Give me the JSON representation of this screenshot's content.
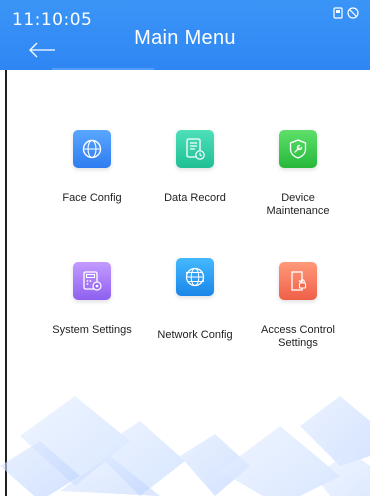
{
  "status_bar": {
    "time": "11:10:05"
  },
  "header": {
    "title": "Main Menu",
    "back_icon": "arrow-left-icon"
  },
  "menu": {
    "items": [
      {
        "id": "face-config",
        "label": "Face Config",
        "icon": "face-scan-icon",
        "color_top": "#5aa7ff",
        "color_bottom": "#2e7cf0"
      },
      {
        "id": "data-record",
        "label": "Data Record",
        "icon": "document-clock-icon",
        "color_top": "#4fe0b8",
        "color_bottom": "#1fbf94"
      },
      {
        "id": "device-maintenance",
        "label": "Device\nMaintenance",
        "icon": "wrench-shield-icon",
        "color_top": "#5ee06b",
        "color_bottom": "#26b83a"
      },
      {
        "id": "system-settings",
        "label": "System Settings",
        "icon": "calculator-gear-icon",
        "color_top": "#c49bff",
        "color_bottom": "#8e60f0"
      },
      {
        "id": "network-config",
        "label": "Network Config",
        "icon": "globe-icon",
        "color_top": "#45b9ff",
        "color_bottom": "#1a86e8"
      },
      {
        "id": "access-control-settings",
        "label": "Access Control\nSettings",
        "icon": "door-lock-icon",
        "color_top": "#ff9a7a",
        "color_bottom": "#f05f48"
      }
    ]
  },
  "colors": {
    "header_blue": "#2f86f3",
    "text_dark": "#222222"
  }
}
